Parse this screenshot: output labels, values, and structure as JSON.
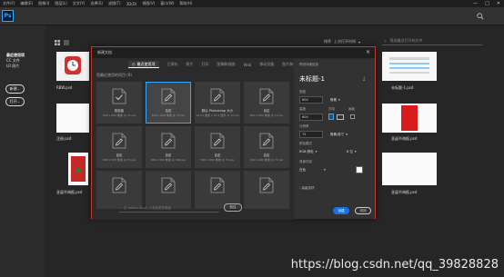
{
  "menubar": {
    "items": [
      "文件(F)",
      "编辑(E)",
      "图像(I)",
      "图层(L)",
      "文字(Y)",
      "选择(S)",
      "滤镜(T)",
      "3D(D)",
      "视图(V)",
      "窗口(W)",
      "帮助(H)"
    ],
    "window_controls": [
      "—",
      "□",
      "✕"
    ]
  },
  "app": {
    "logo": "Ps"
  },
  "start": {
    "nav": {
      "recent": "最近使用项",
      "cc_files": "CC 文件",
      "lr_photos": "LR 照片"
    },
    "new_button": "新建...",
    "open_button": "打开...",
    "sort_label": "排序",
    "sort_value": "上次打开时间",
    "filter_placeholder": "筛选最近打开的文件",
    "recent_files": [
      "RBW.psd",
      "未标题-1.psd",
      "注册.psd",
      "圣诞节海报.psd",
      "圣诞节海报.psd",
      "圣诞节海报.psd"
    ]
  },
  "dialog": {
    "title": "新建文档",
    "tabs": [
      "最近使用项",
      "已保存",
      "照片",
      "打印",
      "图稿和插图",
      "Web",
      "移动设备",
      "胶片和视频"
    ],
    "section_title": "您最近使用的项目 (9)",
    "presets": [
      {
        "name": "剪贴板",
        "sub": "800 x 600 像素 @ 72 ppi"
      },
      {
        "name": "自定",
        "sub": "600 x 600 像素 @ 72 ppi"
      },
      {
        "name": "默认 Photoshop 大小",
        "sub": "16.51 厘米 x 21.5 厘米 @ 72 ppi"
      },
      {
        "name": "自定",
        "sub": "800 x 800 像素 @ 72 ppi"
      },
      {
        "name": "自定",
        "sub": "800 x 500 像素 @ 72 ppi"
      },
      {
        "name": "自定",
        "sub": "800 x 500 像素 @ 300 ppi"
      },
      {
        "name": "自定",
        "sub": "800 x 500 像素 @ 72 ppi"
      },
      {
        "name": "自定",
        "sub": "460 x 460 像素 @ 72 ppi"
      },
      {
        "name": "",
        "sub": ""
      },
      {
        "name": "",
        "sub": ""
      },
      {
        "name": "",
        "sub": ""
      },
      {
        "name": "",
        "sub": ""
      }
    ],
    "stock_search_placeholder": "在 Adobe Stock 上查找更多模板",
    "go_button": "前往",
    "details": {
      "section_label": "预设详细信息",
      "doc_name": "未标题-1",
      "width_label": "宽度",
      "width_value": "600",
      "width_unit": "像素",
      "height_label": "高度",
      "height_value": "600",
      "orientation_label": "方向",
      "artboard_label": "画板",
      "resolution_label": "分辨率",
      "resolution_value": "72",
      "resolution_unit": "像素/英寸",
      "color_mode_label": "颜色模式",
      "color_mode_value": "RGB 颜色",
      "bit_depth": "8 位",
      "background_label": "背景内容",
      "background_value": "白色",
      "advanced_label": "高级选项"
    },
    "create_button": "创建",
    "close_button": "关闭"
  },
  "watermark": "https://blog.csdn.net/qq_39828828"
}
